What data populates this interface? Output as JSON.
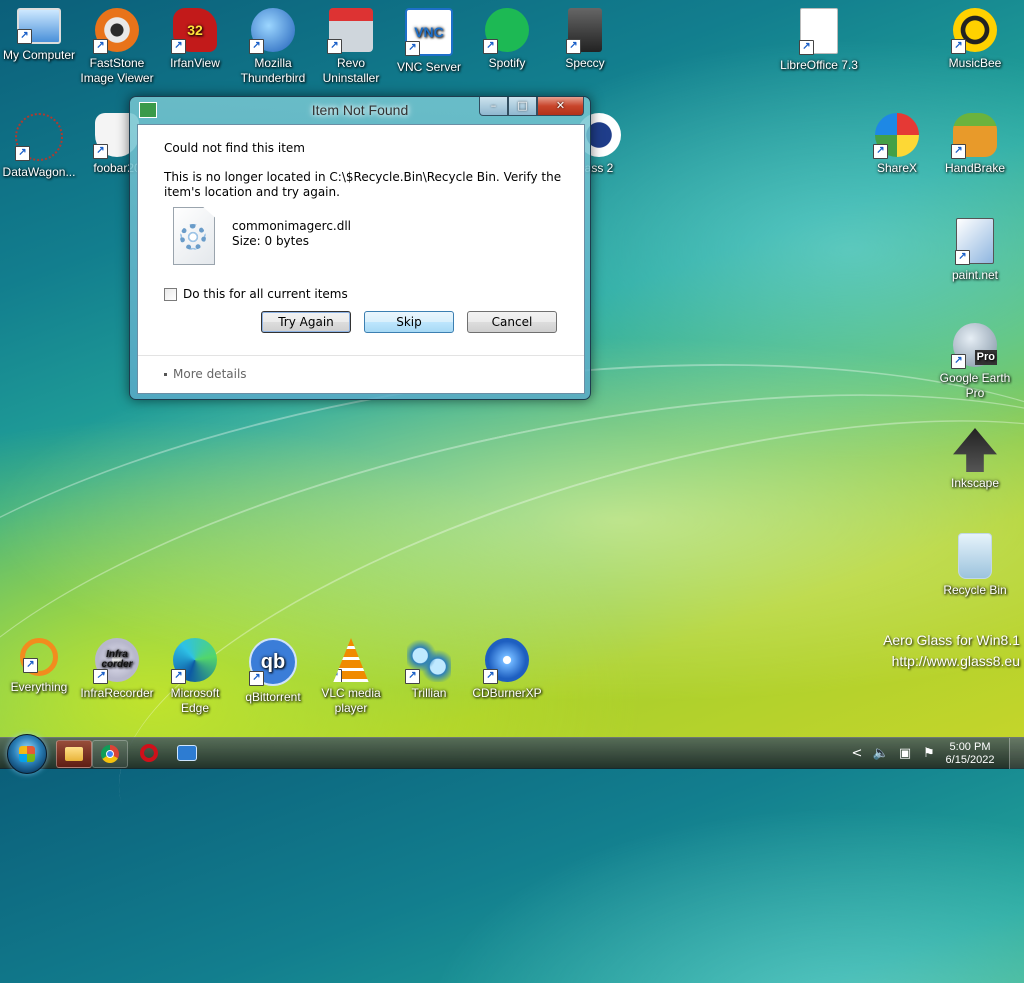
{
  "desktop": {
    "icons": [
      {
        "id": "my-computer",
        "label": "My Computer",
        "icon": "computer-icon"
      },
      {
        "id": "faststone",
        "label": "FastStone Image Viewer",
        "icon": "faststone-icon"
      },
      {
        "id": "irfanview",
        "label": "IrfanView",
        "icon": "irfanview-icon",
        "badge": "32"
      },
      {
        "id": "thunderbird",
        "label": "Mozilla Thunderbird",
        "icon": "thunderbird-icon"
      },
      {
        "id": "revo",
        "label": "Revo Uninstaller",
        "icon": "revo-icon"
      },
      {
        "id": "vnc",
        "label": "VNC Server",
        "icon": "vnc-icon",
        "glyph_text": "VNC"
      },
      {
        "id": "spotify",
        "label": "Spotify",
        "icon": "spotify-icon"
      },
      {
        "id": "speccy",
        "label": "Speccy",
        "icon": "speccy-icon"
      },
      {
        "id": "libreoffice",
        "label": "LibreOffice 7.3",
        "icon": "libreoffice-icon"
      },
      {
        "id": "musicbee",
        "label": "MusicBee",
        "icon": "musicbee-icon"
      },
      {
        "id": "datawagon",
        "label": "DataWagon...",
        "icon": "datawagon-icon"
      },
      {
        "id": "foobar",
        "label": "foobar20",
        "icon": "foobar-icon"
      },
      {
        "id": "glass2",
        "label": "ass 2",
        "icon": "glass-icon"
      },
      {
        "id": "sharex",
        "label": "ShareX",
        "icon": "sharex-icon"
      },
      {
        "id": "handbrake",
        "label": "HandBrake",
        "icon": "handbrake-icon"
      },
      {
        "id": "paintnet",
        "label": "paint.net",
        "icon": "paintnet-icon"
      },
      {
        "id": "googleearth",
        "label": "Google Earth Pro",
        "icon": "google-earth-icon",
        "badge": "Pro"
      },
      {
        "id": "inkscape",
        "label": "Inkscape",
        "icon": "inkscape-icon"
      },
      {
        "id": "recyclebin",
        "label": "Recycle Bin",
        "icon": "recycle-bin-icon"
      },
      {
        "id": "everything",
        "label": "Everything",
        "icon": "everything-icon"
      },
      {
        "id": "infrarecorder",
        "label": "InfraRecorder",
        "icon": "infrarecorder-icon",
        "glyph_text": "Infra\ncorder"
      },
      {
        "id": "edge",
        "label": "Microsoft Edge",
        "icon": "edge-icon"
      },
      {
        "id": "qbittorrent",
        "label": "qBittorrent",
        "icon": "qbittorrent-icon",
        "glyph_text": "qb"
      },
      {
        "id": "vlc",
        "label": "VLC media player",
        "icon": "vlc-icon"
      },
      {
        "id": "trillian",
        "label": "Trillian",
        "icon": "trillian-icon"
      },
      {
        "id": "cdburnerxp",
        "label": "CDBurnerXP",
        "icon": "cdburnerxp-icon"
      }
    ],
    "watermark": {
      "line1": "Aero Glass for Win8.1",
      "line2": "http://www.glass8.eu"
    }
  },
  "dialog": {
    "title": "Item Not Found",
    "buttons": {
      "minimize": "–",
      "maximize": "□",
      "close": "✕"
    },
    "heading": "Could not find this item",
    "message": "This is no longer located in C:\\$Recycle.Bin\\Recycle Bin. Verify the item's location and try again.",
    "file": {
      "name": "commonimagerc.dll",
      "size": "Size: 0 bytes"
    },
    "checkbox_label": "Do this for all current items",
    "actions": {
      "try_again": "Try Again",
      "skip": "Skip",
      "cancel": "Cancel"
    },
    "more_details": "More details"
  },
  "taskbar": {
    "tray_chevron": "<",
    "clock": {
      "time": "5:00 PM",
      "date": "6/15/2022"
    }
  },
  "colors": {
    "accent": "#2a7fb8",
    "close_button": "#c8452b",
    "desktop_teal": "#127e8e",
    "desktop_lime": "#c8d62b"
  }
}
